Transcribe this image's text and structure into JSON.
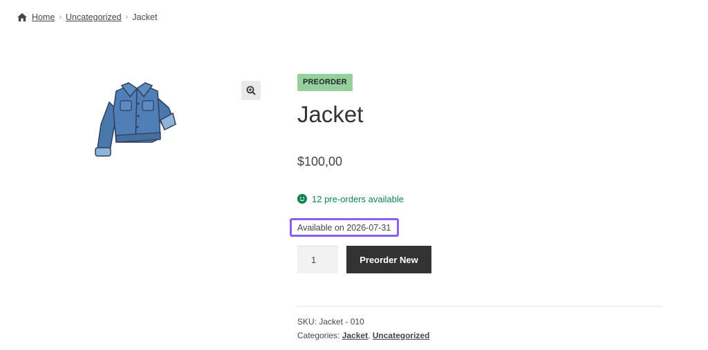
{
  "breadcrumb": {
    "home_icon": "home-icon",
    "home": "Home",
    "sep1": "›",
    "category": "Uncategorized",
    "sep2": "›",
    "current": "Jacket"
  },
  "gallery": {
    "image": "jacket-image",
    "zoom_icon": "zoom-in-icon"
  },
  "product": {
    "badge": "PREORDER",
    "title": "Jacket",
    "price": "$100,00",
    "stock_icon": "smile-icon",
    "stock": "12 pre-orders available",
    "available_on": "Available on 2026-07-31",
    "quantity": "1",
    "button": "Preorder New"
  },
  "meta": {
    "sku_label": "SKU: ",
    "sku": "Jacket - 010",
    "categories_label": "Categories: ",
    "cat1": "Jacket",
    "cat_sep": ", ",
    "cat2": "Uncategorized"
  },
  "colors": {
    "badge_bg": "#95cf9c",
    "stock_green": "#0f834d",
    "highlight_border": "#8b5cf6",
    "button_bg": "#333333"
  }
}
